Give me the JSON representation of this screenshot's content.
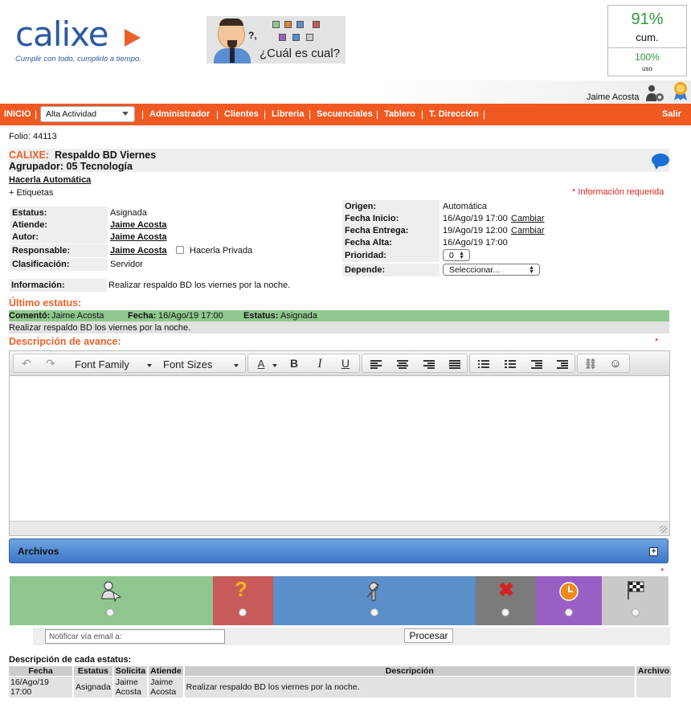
{
  "brand": {
    "logo_text": "calixe",
    "tagline": "Cumplir con todo, cumplirlo a tiempo.",
    "banner_text": "¿Cuál es cual?",
    "banner_question": "?,",
    "accent_color": "#f05a22",
    "logo_color": "#2a5aa0"
  },
  "stats": {
    "cum_pct": "91%",
    "cum_label": "cum.",
    "uso_pct": "100%",
    "uso_label": "uso"
  },
  "user": {
    "name": "Jaime Acosta"
  },
  "nav": {
    "inicio": "INICIO",
    "select_value": "Alta Actividad",
    "items": [
      "Administrador",
      "Clientes",
      "Libreria",
      "Secuenciales",
      "Tablero",
      "T. Dirección"
    ],
    "salir": "Salir"
  },
  "ticket": {
    "folio": "Folio: 44113",
    "client": "CALIXE:",
    "title": "Respaldo BD Viernes",
    "group": "Agrupador: 05 Tecnología",
    "make_auto": "Hacerla Automática",
    "tags": "+ Etiquetas",
    "required_note": "* Información requerida",
    "fields_left": [
      {
        "label": "Estatus:",
        "value": "Asignada",
        "link": false
      },
      {
        "label": "Atiende:",
        "value": "Jaime Acosta",
        "link": true
      },
      {
        "label": "Autor:",
        "value": "Jaime Acosta",
        "link": true
      },
      {
        "label": "Responsable:",
        "value": "Jaime Acosta",
        "link": true
      },
      {
        "label": "Clasificación:",
        "value": "Servidor",
        "link": false
      }
    ],
    "private_label": "Hacerla Privada",
    "fields_right": [
      {
        "label": "Origen:",
        "value": "Automática"
      },
      {
        "label": "Fecha Inicio:",
        "value": "16/Ago/19 17:00",
        "action": "Cambiar"
      },
      {
        "label": "Fecha Entrega:",
        "value": "19/Ago/19 12:00",
        "action": "Cambiar"
      },
      {
        "label": "Fecha Alta:",
        "value": "16/Ago/19 17:00"
      }
    ],
    "prioridad_label": "Prioridad:",
    "prioridad_value": "0",
    "depende_label": "Depende:",
    "depende_value": "Seleccionar...",
    "info_label": "Información:",
    "info_value": "Realizar respaldo BD los viernes por la noche."
  },
  "last_status": {
    "heading": "Último estatus:",
    "comento_label": "Comentó:",
    "comento_value": "Jaime Acosta",
    "fecha_label": "Fecha:",
    "fecha_value": "16/Ago/19 17:00",
    "estatus_label": "Estatus:",
    "estatus_value": "Asignada",
    "text": "Realizar respaldo BD los viernes por la noche."
  },
  "progress": {
    "heading": "Descripción de avance:",
    "required_mark": "*",
    "font_family": "Font Family",
    "font_sizes": "Font Sizes"
  },
  "archivos": {
    "label": "Archivos",
    "plus": "+"
  },
  "steps": [
    {
      "name": "assign",
      "color": "#90c590",
      "icon": "user-pointer-icon"
    },
    {
      "name": "question",
      "color": "#c85a5a",
      "icon": "question-icon"
    },
    {
      "name": "working",
      "color": "#5b8fca",
      "icon": "tools-icon"
    },
    {
      "name": "cancel",
      "color": "#7b7b7b",
      "icon": "x-icon"
    },
    {
      "name": "pending",
      "color": "#9a5fc4",
      "icon": "clock-icon"
    },
    {
      "name": "finish",
      "color": "#c9c9c9",
      "icon": "flag-icon"
    }
  ],
  "notify": {
    "placeholder": "Notificar vía email a:",
    "process_label": "Procesar"
  },
  "history": {
    "heading": "Descripción de cada estatus:",
    "columns": [
      "Fecha",
      "Estatus",
      "Solicita",
      "Atiende",
      "Descripción",
      "Archivo"
    ],
    "rows": [
      {
        "fecha": "16/Ago/19 17:00",
        "estatus": "Asignada",
        "solicita": "Jaime Acosta",
        "atiende": "Jaime Acosta",
        "descripcion": "Realizar respaldo BD los viernes por la noche.",
        "archivo": ""
      }
    ]
  }
}
